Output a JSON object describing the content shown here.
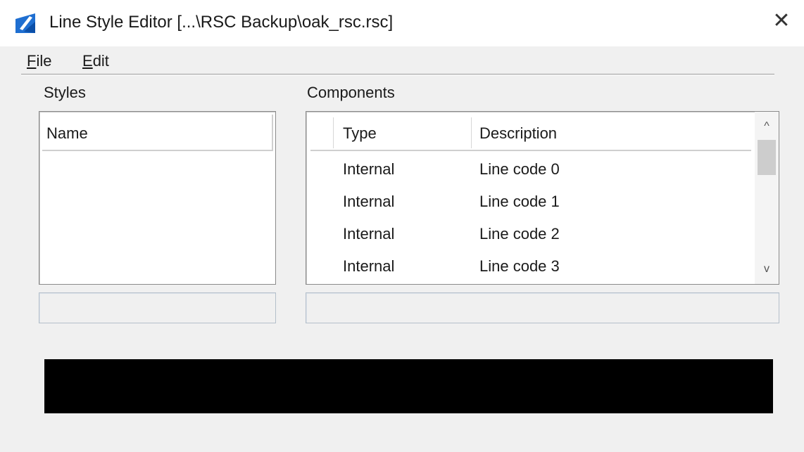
{
  "window": {
    "title": "Line Style Editor [...\\RSC Backup\\oak_rsc.rsc]",
    "close_glyph": "✕"
  },
  "menu": [
    {
      "mnemonic": "F",
      "rest": "ile"
    },
    {
      "mnemonic": "E",
      "rest": "dit"
    }
  ],
  "styles": {
    "label": "Styles",
    "column_header": "Name",
    "items": [],
    "field_value": ""
  },
  "components": {
    "label": "Components",
    "columns": [
      "Type",
      "Description"
    ],
    "rows": [
      {
        "type": "Internal",
        "description": "Line code 0"
      },
      {
        "type": "Internal",
        "description": "Line code 1"
      },
      {
        "type": "Internal",
        "description": "Line code 2"
      },
      {
        "type": "Internal",
        "description": "Line code 3"
      }
    ],
    "field_value": "",
    "scroll_up_glyph": "^",
    "scroll_down_glyph": "v"
  },
  "preview": {
    "background": "#000000"
  },
  "colors": {
    "app_icon_blue": "#1f6fd1"
  }
}
